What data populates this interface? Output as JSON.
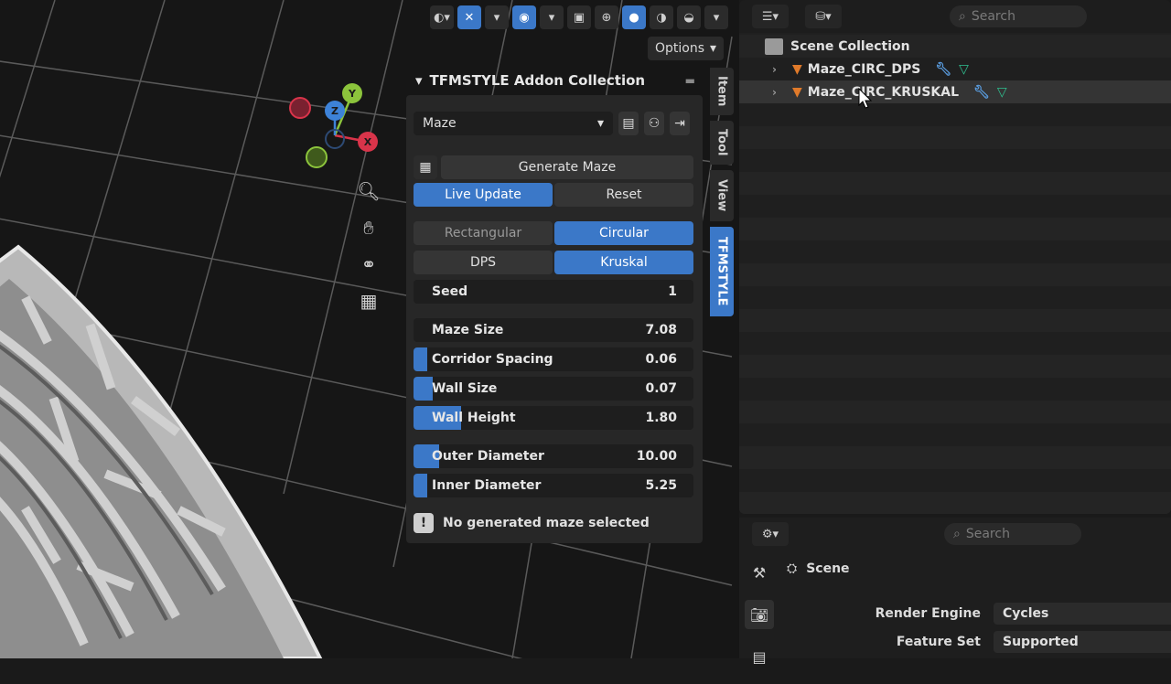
{
  "viewport": {
    "options_label": "Options",
    "side_tabs": [
      "Item",
      "Tool",
      "View",
      "TFMSTYLE"
    ],
    "gizmo": {
      "x": "X",
      "y": "Y",
      "z": "Z"
    }
  },
  "npanel": {
    "title": "TFMSTYLE Addon Collection",
    "dropdown_value": "Maze",
    "generate_label": "Generate Maze",
    "live_update_label": "Live Update",
    "reset_label": "Reset",
    "shape": {
      "rectangular": "Rectangular",
      "circular": "Circular",
      "selected": "Circular"
    },
    "algorithm": {
      "dps": "DPS",
      "kruskal": "Kruskal",
      "selected": "Kruskal"
    },
    "seed": {
      "label": "Seed",
      "value": "1"
    },
    "maze_size": {
      "label": "Maze Size",
      "value": "7.08"
    },
    "corridor_spacing": {
      "label": "Corridor Spacing",
      "value": "0.06",
      "fill_fraction": 0.05
    },
    "wall_size": {
      "label": "Wall Size",
      "value": "0.07",
      "fill_fraction": 0.07
    },
    "wall_height": {
      "label": "Wall Height",
      "value": "1.80",
      "fill_fraction": 0.17
    },
    "outer_diameter": {
      "label": "Outer Diameter",
      "value": "10.00",
      "fill_fraction": 0.09
    },
    "inner_diameter": {
      "label": "Inner Diameter",
      "value": "5.25",
      "fill_fraction": 0.05
    },
    "info_text": "No generated maze selected"
  },
  "outliner": {
    "search_placeholder": "Search",
    "scene_collection": "Scene Collection",
    "items": [
      {
        "name": "Maze_CIRC_DPS"
      },
      {
        "name": "Maze_CIRC_KRUSKAL"
      }
    ]
  },
  "properties": {
    "search_placeholder": "Search",
    "context": "Scene",
    "render_engine": {
      "label": "Render Engine",
      "value": "Cycles"
    },
    "feature_set": {
      "label": "Feature Set",
      "value": "Supported"
    }
  },
  "colors": {
    "accent": "#3b78c8",
    "x_axis": "#d9344a",
    "y_axis": "#8cc43c",
    "z_axis": "#3d82d8",
    "object_orange": "#e07a2a",
    "mesh_teal": "#2fbf8f"
  }
}
